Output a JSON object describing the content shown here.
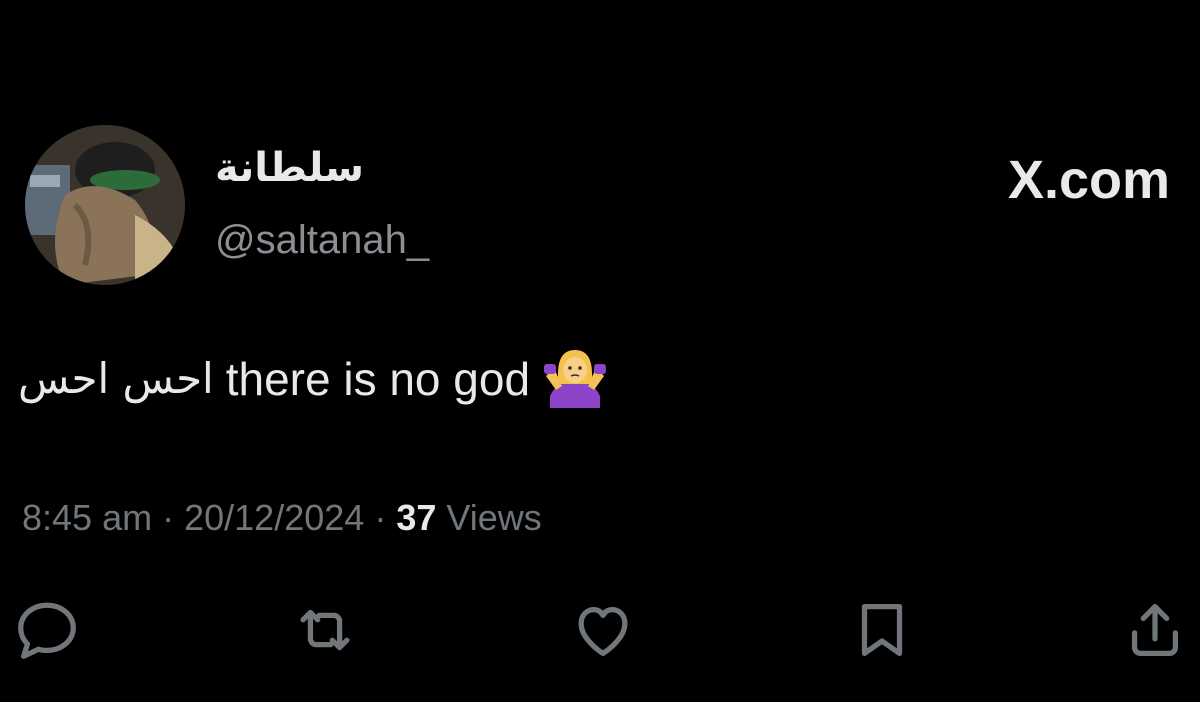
{
  "tweet": {
    "author": {
      "display_name": "سلطانة",
      "handle": "@saltanah_"
    },
    "text_arabic": "احس احس",
    "text_english": "there is no god",
    "emoji": "person-shrugging-emoji",
    "time": "8:45 am",
    "date": "20/12/2024",
    "separator": "·",
    "views_count": "37",
    "views_label": "Views"
  },
  "brand": {
    "watermark_text": "X.com"
  },
  "actions": [
    {
      "name": "reply",
      "icon": "reply-icon"
    },
    {
      "name": "repost",
      "icon": "repost-icon"
    },
    {
      "name": "like",
      "icon": "heart-icon"
    },
    {
      "name": "bookmark",
      "icon": "bookmark-icon"
    },
    {
      "name": "share",
      "icon": "share-icon"
    }
  ],
  "colors": {
    "background": "#000000",
    "primary_text": "#e7e9ea",
    "secondary_text": "#71767b",
    "emoji_purple": "#8e44c9"
  }
}
